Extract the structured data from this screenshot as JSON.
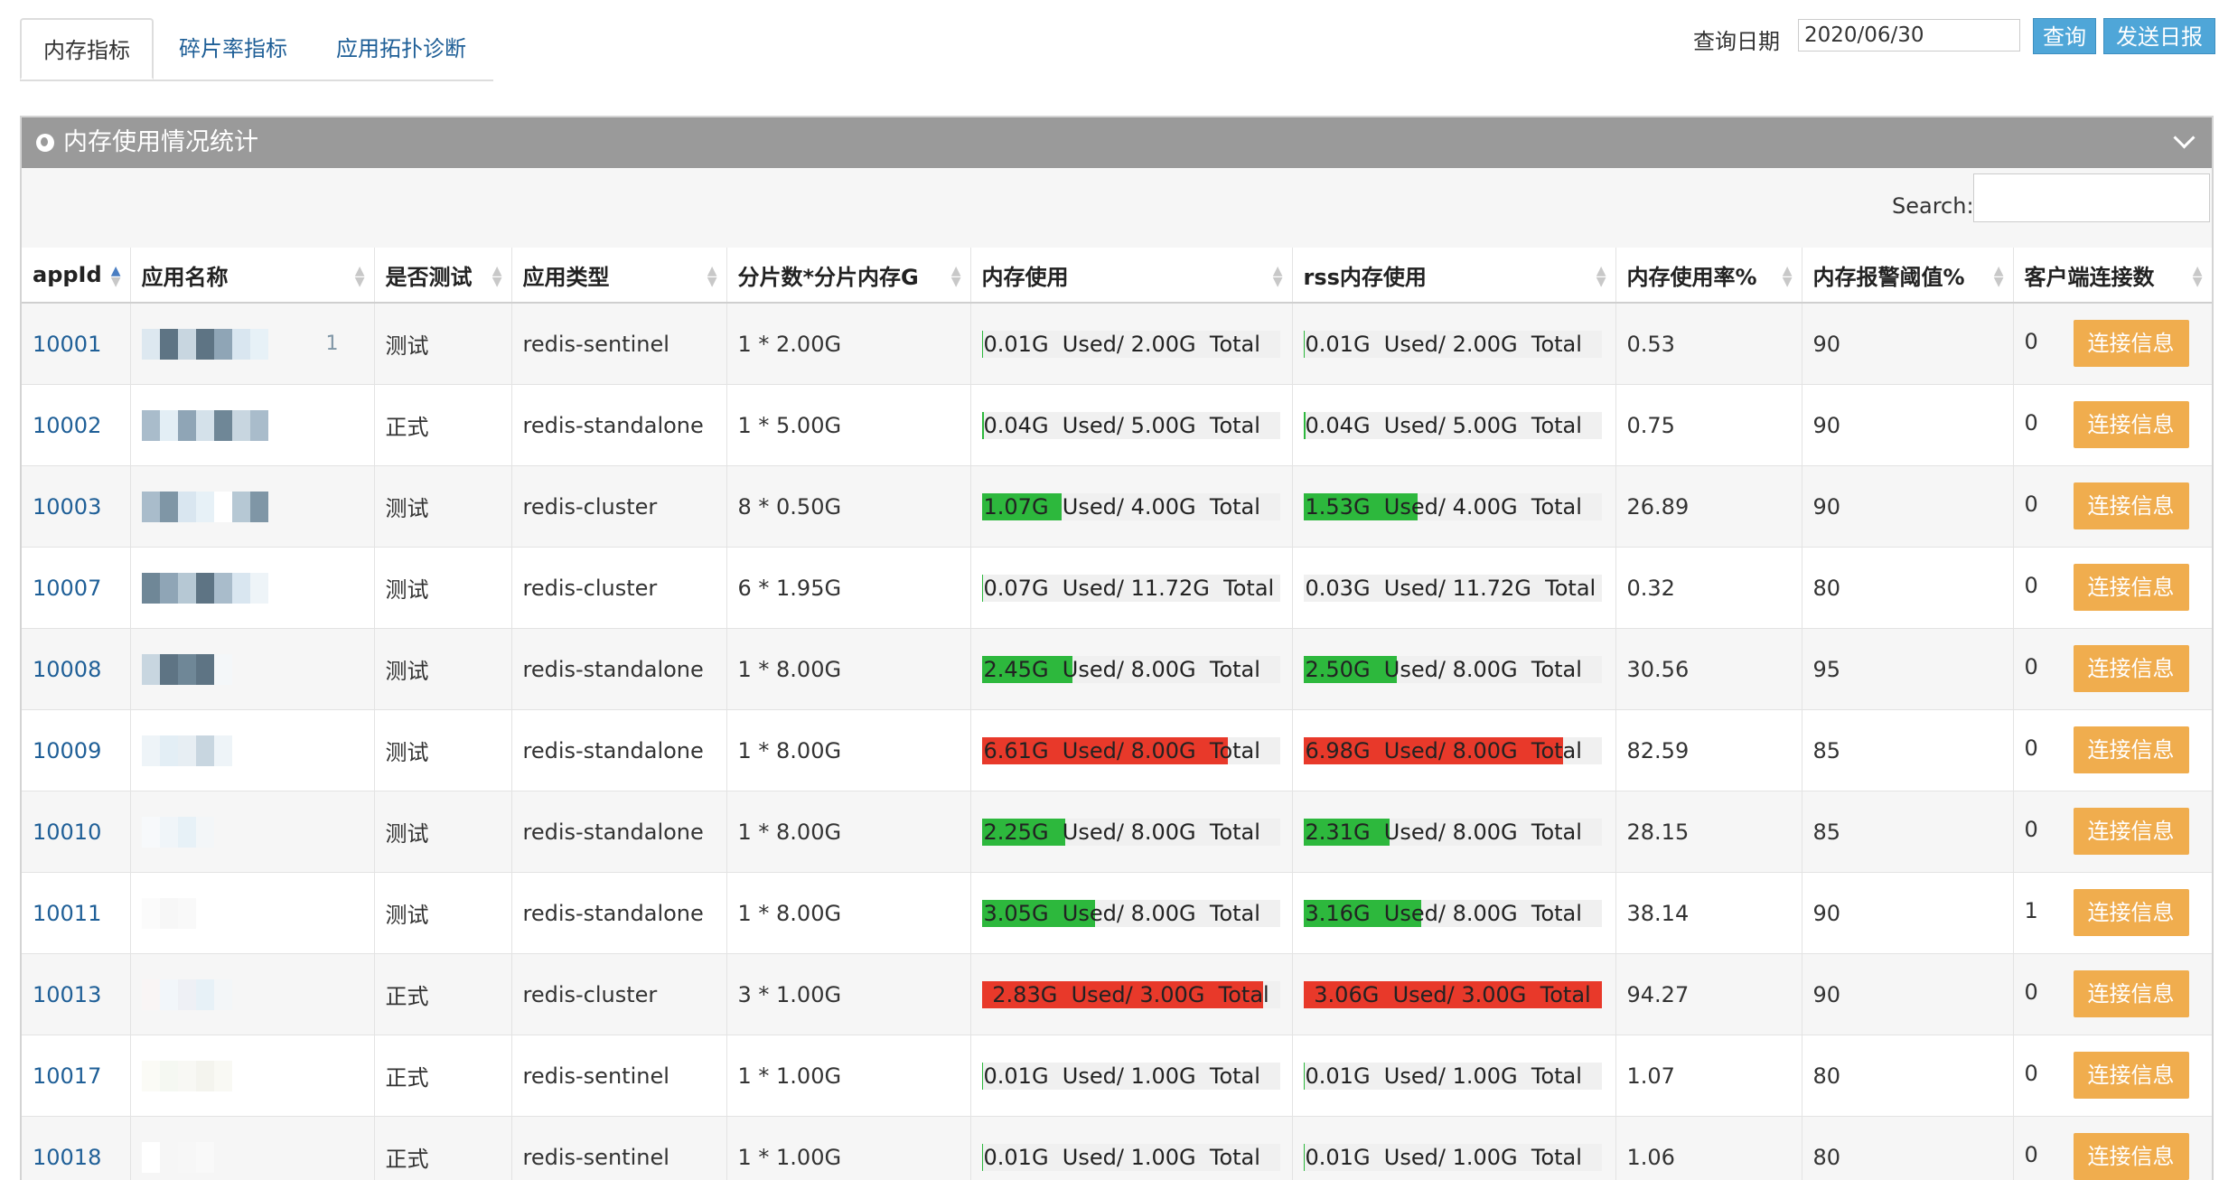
{
  "tabs": [
    "内存指标",
    "碎片率指标",
    "应用拓扑诊断"
  ],
  "query": {
    "date_label": "查询日期",
    "date_value": "2020/06/30",
    "query_button": "查询",
    "report_button": "发送日报"
  },
  "portlet": {
    "title": "内存使用情况统计",
    "search_label": "Search:"
  },
  "colors": {
    "green": "#2db83d",
    "red": "#e8392a",
    "orange_button": "#f0ad4e",
    "blue_button": "#4fa6d8",
    "link": "#1f5f97"
  },
  "table": {
    "columns": [
      "appId",
      "应用名称",
      "是否测试",
      "应用类型",
      "分片数*分片内存G",
      "内存使用",
      "rss内存使用",
      "内存使用率%",
      "内存报警阈值%",
      "客户端连接数"
    ],
    "sorted_column": "appId",
    "rows": [
      {
        "appId": "10001",
        "name_tail": "1",
        "test": "测试",
        "type": "redis-sentinel",
        "shards": "1 * 2.00G",
        "mem_text": "0.01G  Used/ 2.00G  Total",
        "mem_ratio": 0.005,
        "mem_color": "green",
        "rss_text": "0.01G  Used/ 2.00G  Total",
        "rss_ratio": 0.005,
        "rss_color": "green",
        "rate": "0.53",
        "alarm": "90",
        "conn": "0",
        "conn_button": "连接信息"
      },
      {
        "appId": "10002",
        "name_tail": "",
        "test": "正式",
        "type": "redis-standalone",
        "shards": "1 * 5.00G",
        "mem_text": "0.04G  Used/ 5.00G  Total",
        "mem_ratio": 0.008,
        "mem_color": "green",
        "rss_text": "0.04G  Used/ 5.00G  Total",
        "rss_ratio": 0.008,
        "rss_color": "green",
        "rate": "0.75",
        "alarm": "90",
        "conn": "0",
        "conn_button": "连接信息"
      },
      {
        "appId": "10003",
        "name_tail": "",
        "test": "测试",
        "type": "redis-cluster",
        "shards": "8 * 0.50G",
        "mem_text": "1.07G  Used/ 4.00G  Total",
        "mem_ratio": 0.2675,
        "mem_color": "green",
        "rss_text": "1.53G  Used/ 4.00G  Total",
        "rss_ratio": 0.3825,
        "rss_color": "green",
        "rate": "26.89",
        "alarm": "90",
        "conn": "0",
        "conn_button": "连接信息"
      },
      {
        "appId": "10007",
        "name_tail": "",
        "test": "测试",
        "type": "redis-cluster",
        "shards": "6 * 1.95G",
        "mem_text": "0.07G  Used/ 11.72G  Total",
        "mem_ratio": 0.006,
        "mem_color": "green",
        "rss_text": "0.03G  Used/ 11.72G  Total",
        "rss_ratio": 0.0,
        "rss_color": "green",
        "rate": "0.32",
        "alarm": "80",
        "conn": "0",
        "conn_button": "连接信息"
      },
      {
        "appId": "10008",
        "name_tail": "",
        "test": "测试",
        "type": "redis-standalone",
        "shards": "1 * 8.00G",
        "mem_text": "2.45G  Used/ 8.00G  Total",
        "mem_ratio": 0.306,
        "mem_color": "green",
        "rss_text": "2.50G  Used/ 8.00G  Total",
        "rss_ratio": 0.3125,
        "rss_color": "green",
        "rate": "30.56",
        "alarm": "95",
        "conn": "0",
        "conn_button": "连接信息"
      },
      {
        "appId": "10009",
        "name_tail": "",
        "test": "测试",
        "type": "redis-standalone",
        "shards": "1 * 8.00G",
        "mem_text": "6.61G  Used/ 8.00G  Total",
        "mem_ratio": 0.826,
        "mem_color": "red",
        "rss_text": "6.98G  Used/ 8.00G  Total",
        "rss_ratio": 0.8725,
        "rss_color": "red",
        "rate": "82.59",
        "alarm": "85",
        "conn": "0",
        "conn_button": "连接信息"
      },
      {
        "appId": "10010",
        "name_tail": "",
        "test": "测试",
        "type": "redis-standalone",
        "shards": "1 * 8.00G",
        "mem_text": "2.25G  Used/ 8.00G  Total",
        "mem_ratio": 0.281,
        "mem_color": "green",
        "rss_text": "2.31G  Used/ 8.00G  Total",
        "rss_ratio": 0.289,
        "rss_color": "green",
        "rate": "28.15",
        "alarm": "85",
        "conn": "0",
        "conn_button": "连接信息"
      },
      {
        "appId": "10011",
        "name_tail": "",
        "test": "测试",
        "type": "redis-standalone",
        "shards": "1 * 8.00G",
        "mem_text": "3.05G  Used/ 8.00G  Total",
        "mem_ratio": 0.381,
        "mem_color": "green",
        "rss_text": "3.16G  Used/ 8.00G  Total",
        "rss_ratio": 0.395,
        "rss_color": "green",
        "rate": "38.14",
        "alarm": "90",
        "conn": "1",
        "conn_button": "连接信息"
      },
      {
        "appId": "10013",
        "name_tail": "",
        "test": "正式",
        "type": "redis-cluster",
        "shards": "3 * 1.00G",
        "mem_text": "2.83G  Used/ 3.00G  Total",
        "mem_ratio": 0.943,
        "mem_color": "red",
        "rss_text": "3.06G  Used/ 3.00G  Total",
        "rss_ratio": 1.0,
        "rss_color": "red",
        "rate": "94.27",
        "alarm": "90",
        "conn": "0",
        "conn_button": "连接信息"
      },
      {
        "appId": "10017",
        "name_tail": "",
        "test": "正式",
        "type": "redis-sentinel",
        "shards": "1 * 1.00G",
        "mem_text": "0.01G  Used/ 1.00G  Total",
        "mem_ratio": 0.005,
        "mem_color": "green",
        "rss_text": "0.01G  Used/ 1.00G  Total",
        "rss_ratio": 0.005,
        "rss_color": "green",
        "rate": "1.07",
        "alarm": "80",
        "conn": "0",
        "conn_button": "连接信息"
      },
      {
        "appId": "10018",
        "name_tail": "",
        "test": "正式",
        "type": "redis-sentinel",
        "shards": "1 * 1.00G",
        "mem_text": "0.01G  Used/ 1.00G  Total",
        "mem_ratio": 0.005,
        "mem_color": "green",
        "rss_text": "0.01G  Used/ 1.00G  Total",
        "rss_ratio": 0.005,
        "rss_color": "green",
        "rate": "1.06",
        "alarm": "80",
        "conn": "0",
        "conn_button": "连接信息"
      }
    ]
  }
}
